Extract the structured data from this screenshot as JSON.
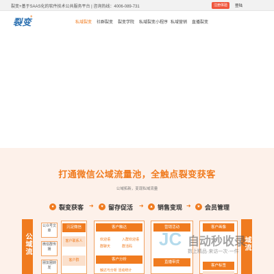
{
  "topbar": {
    "text": "裂变+基于SAAS化的软件技术公共服务平台 | 咨询热线：4006-089-731",
    "trial_label": "注册体验",
    "login_label": "登陆"
  },
  "header": {
    "logo": "裂变",
    "logo_plus": "+",
    "nav": [
      "私域裂变",
      "社群裂变",
      "裂变学院",
      "私域裂变小程序",
      "私域营销",
      "直播裂变"
    ]
  },
  "section": {
    "title": "打通微信公域流量池，全触点裂变获客",
    "subtitle": "公域拓新，变现私域流量",
    "steps": [
      "裂变获客",
      "留存促活",
      "销售变现",
      "会员管理"
    ],
    "left_pillar": "公域流",
    "right_pillar": "域流",
    "col1_cards": [
      "公众号文章",
      "微信群传播",
      "朋友圈转发"
    ],
    "col2_items": [
      "沉淀微信",
      "客户联系人",
      "客户群"
    ],
    "col3_head": "客户触达",
    "col3_items": [
      "欢迎语",
      "入群欢迎语",
      "群聊天",
      "群活码"
    ],
    "col3_head2": "客户分析",
    "col3_bottom": "触达与分析  活动统计",
    "col4_items": [
      "营销活动",
      "直播带货"
    ],
    "col5_items": [
      "客户画像",
      "客户标签",
      "客户等级"
    ]
  },
  "watermark": {
    "logo": "JC",
    "brand": "自动秒收录",
    "slogan": "数上精品·来访一次·一件"
  },
  "colors": {
    "accent": "#f07b1f",
    "brand_blue": "#2a6fb0",
    "section_bg": "#fdf1ea"
  }
}
